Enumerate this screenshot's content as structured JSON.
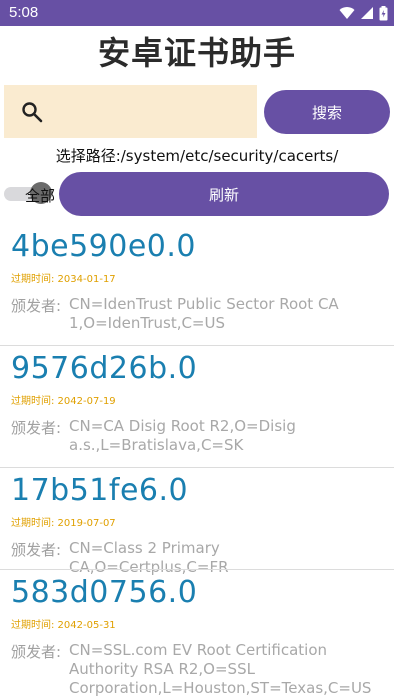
{
  "status_bar": {
    "time": "5:08"
  },
  "app": {
    "title": "安卓证书助手"
  },
  "search": {
    "placeholder": "",
    "button_label": "搜索"
  },
  "path": {
    "text": "选择路径:/system/etc/security/cacerts/"
  },
  "filter": {
    "toggle_label": "全部",
    "toggle_on": true,
    "refresh_label": "刷新"
  },
  "certificates": [
    {
      "hash": "4be590e0.0",
      "expiry": "过期时间: 2034-01-17",
      "issuer_label": "颁发者:",
      "issuer_lines": [
        "CN=IdenTrust Public Sector Root CA",
        "1,O=IdenTrust,C=US"
      ]
    },
    {
      "hash": "9576d26b.0",
      "expiry": "过期时间: 2042-07-19",
      "issuer_label": "颁发者:",
      "issuer_lines": [
        "CN=CA Disig Root R2,O=Disig",
        "a.s.,L=Bratislava,C=SK"
      ]
    },
    {
      "hash": "17b51fe6.0",
      "expiry": "过期时间: 2019-07-07",
      "issuer_label": "颁发者:",
      "issuer_lines": [
        "CN=Class 2 Primary CA,O=Certplus,C=FR"
      ]
    },
    {
      "hash": "583d0756.0",
      "expiry": "过期时间: 2042-05-31",
      "issuer_label": "颁发者:",
      "issuer_lines": [
        "CN=SSL.com EV Root Certification",
        "Authority RSA R2,O=SSL",
        "Corporation,L=Houston,ST=Texas,C=US"
      ]
    }
  ],
  "colors": {
    "accent": "#6750a4",
    "hash": "#1a7fb0",
    "expiry": "#e0a000",
    "search_bg": "#faebd0"
  }
}
